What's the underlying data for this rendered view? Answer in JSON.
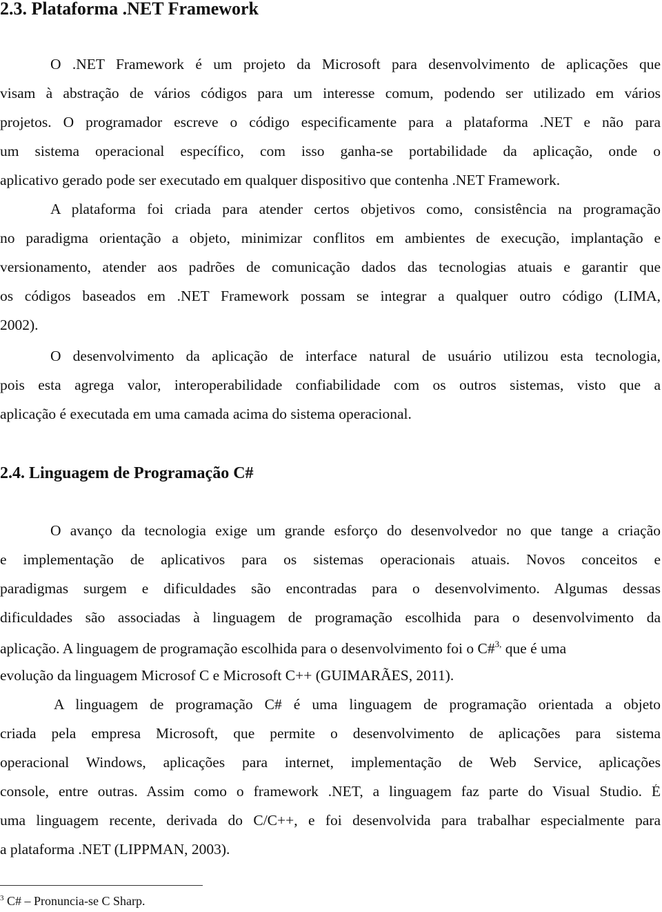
{
  "sections": [
    {
      "heading": "2.3. Plataforma .NET Framework",
      "paragraphs": [
        {
          "lines": [
            "O .NET Framework é um projeto da Microsoft para desenvolvimento de aplicações que",
            "visam à abstração de vários códigos para um interesse comum, podendo ser utilizado em vários",
            "projetos. O programador escreve o código especificamente para a plataforma  .NET e não para",
            "um sistema operacional específico, com isso ganha-se portabilidade da aplicação, onde o",
            "aplicativo gerado pode ser executado em qualquer dispositivo que contenha .NET Framework."
          ]
        },
        {
          "lines": [
            "A plataforma foi criada para atender certos objetivos como, consistência na programação",
            "no paradigma orientação a objeto, minimizar conflitos em ambientes de execução, implantação e",
            "versionamento, atender aos padrões de comunicação dados das tecnologias atuais e garantir que",
            "os códigos baseados em .NET Framework possam se integrar a qualquer outro código (LIMA,",
            "2002)."
          ]
        },
        {
          "lines": [
            "O desenvolvimento da aplicação de interface natural de usuário utilizou esta tecnologia,",
            "pois esta agrega valor, interoperabilidade confiabilidade com os outros sistemas, visto que a",
            "aplicação é executada em uma camada acima do sistema operacional."
          ]
        }
      ]
    },
    {
      "heading": "2.4. Linguagem de Programação C#",
      "paragraphs": [
        {
          "lines": [
            "O avanço da tecnologia exige um grande esforço do desenvolvedor no que tange a criação",
            "e implementação de aplicativos para os sistemas operacionais atuais. Novos conceitos e",
            "paradigmas surgem e dificuldades são encontradas para o desenvolvimento. Algumas dessas",
            "dificuldades são associadas à linguagem de programação escolhida para o desenvolvimento da",
            "aplicação. A linguagem de programação escolhida para o desenvolvimento foi o C#",
            "evolução da linguagem Microsof C e Microsoft C++ (GUIMARÃES, 2011)."
          ],
          "footnote_ref": "3,",
          "after_ref": " que é uma"
        },
        {
          "lines": [
            "A linguagem de programação C# é uma linguagem de programação orientada a objeto",
            "criada pela empresa Microsoft, que permite o desenvolvimento de aplicações para sistema",
            "operacional Windows, aplicações para internet, implementação de Web Service, aplicações",
            "console,  entre outras. Assim como o framework .NET, a linguagem faz parte do Visual Studio. É",
            "uma linguagem recente, derivada do C/C++, e foi desenvolvida para trabalhar especialmente para",
            "a plataforma .NET (LIPPMAN, 2003)."
          ]
        }
      ]
    }
  ],
  "footnote": {
    "number": "3",
    "text": " C# – Pronuncia-se C Sharp."
  }
}
